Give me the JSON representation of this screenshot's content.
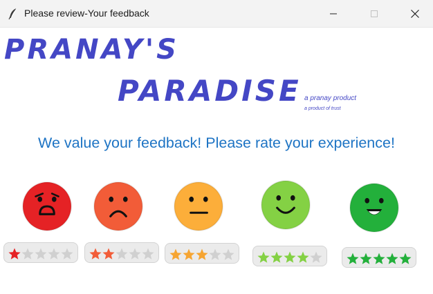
{
  "window": {
    "title": "Please review-Your feedback",
    "icon": "feather-icon",
    "controls": [
      "minimize-icon",
      "maximize-icon",
      "close-icon"
    ]
  },
  "logo": {
    "line1": "PRANAY'S",
    "line2": "PARADISE",
    "tagline1": "a pranay product",
    "tagline2": "a product of trust"
  },
  "prompt": "We value your feedback! Please rate your experience!",
  "ratings": [
    {
      "stars": 1,
      "mood": "very-sad",
      "face_color": "#e52225",
      "star_color": "#e52225"
    },
    {
      "stars": 2,
      "mood": "sad",
      "face_color": "#f25c38",
      "star_color": "#f25c38"
    },
    {
      "stars": 3,
      "mood": "neutral",
      "face_color": "#fcae3a",
      "star_color": "#f6a532"
    },
    {
      "stars": 4,
      "mood": "happy",
      "face_color": "#84d144",
      "star_color": "#84d144"
    },
    {
      "stars": 5,
      "mood": "very-happy",
      "face_color": "#23b03b",
      "star_color": "#23b03b"
    }
  ],
  "colors": {
    "logo": "#4447c5",
    "prompt": "#1e74c4",
    "empty_star": "#d0d0d0",
    "pill_bg": "#ebebeb"
  }
}
